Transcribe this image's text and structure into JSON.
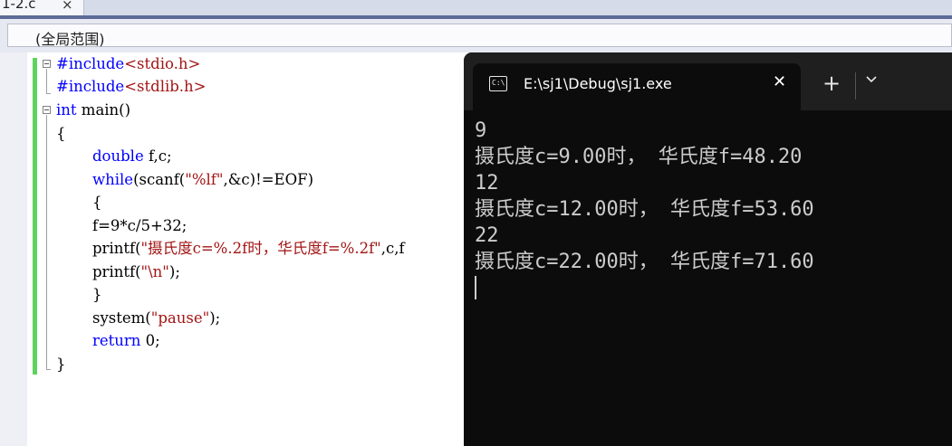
{
  "tab": {
    "label": "1-2.c",
    "close": "×"
  },
  "scope": {
    "label": "(全局范围)"
  },
  "code": {
    "include1_kw": "#include",
    "include1_hdr": "<stdio.h>",
    "include2_kw": "#include",
    "include2_hdr": "<stdlib.h>",
    "main_kw": "int",
    "main_rest": " main()",
    "brace_open": "{",
    "double_kw": "double",
    "double_rest": " f,c;",
    "while_kw": "while",
    "while_a": "(scanf(",
    "while_str": "\"%lf\"",
    "while_b": ",&c)!=EOF)",
    "inner_open": "{",
    "assign": "f=9*c/5+32;",
    "printf1_a": "printf(",
    "printf1_str": "\"摄氏度c=%.2f时，华氏度f=%.2f\"",
    "printf1_b": ",c,f",
    "printf2_a": "printf(",
    "printf2_str": "\"\\n\"",
    "printf2_b": ");",
    "inner_close": "}",
    "system_a": "system(",
    "system_str": "\"pause\"",
    "system_b": ");",
    "return_kw": "return",
    "return_rest": " 0;",
    "brace_close": "}"
  },
  "terminal": {
    "title": "E:\\sj1\\Debug\\sj1.exe",
    "icon_text": "C:\\",
    "close": "✕",
    "new_tab": "+",
    "output": [
      "9",
      "摄氏度c=9.00时， 华氏度f=48.20",
      "12",
      "摄氏度c=12.00时， 华氏度f=53.60",
      "22",
      "摄氏度c=22.00时， 华氏度f=71.60"
    ]
  },
  "colors": {
    "keyword": "#0000ff",
    "string": "#a31515",
    "change_bar": "#5fd35f",
    "terminal_bg": "#0c0c0c"
  }
}
